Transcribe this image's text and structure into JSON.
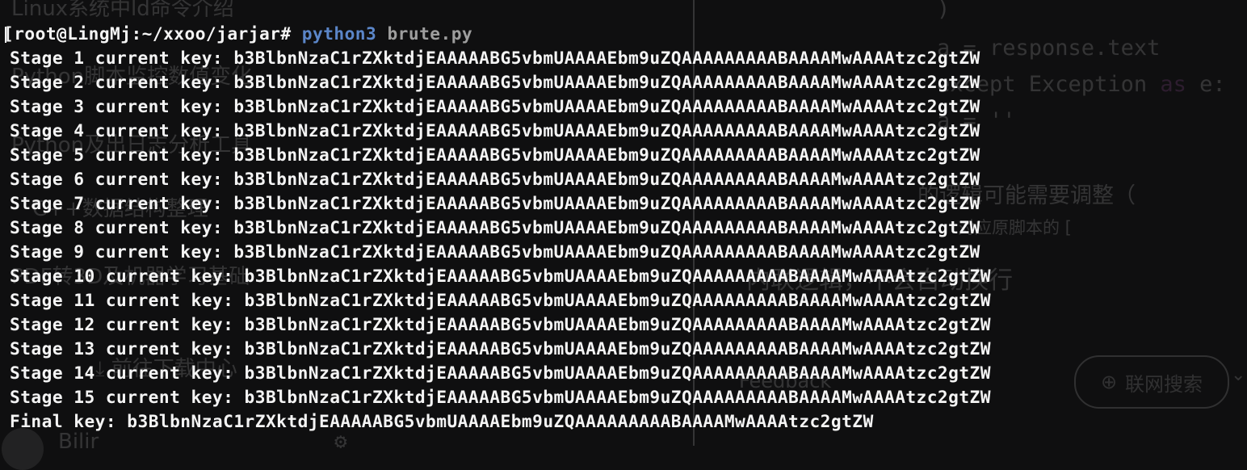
{
  "background": {
    "left_items": [
      "Linux系统中ld命令介绍",
      "Python脚本监控数值变化",
      "Python及出日志分析工具",
      "C++数据结构整理",
      "PDF转3D及机器学习基础",
      "前往下载中心",
      "Bilir"
    ],
    "code_lines": [
      {
        "text": ")"
      },
      {
        "text": "a = response.text"
      },
      {
        "pre": "except Exception ",
        "kw": "as",
        "post": " e:"
      },
      {
        "text": "a = ''"
      }
    ],
    "cjk_lines": [
      "的逻辑可能需要调整（",
      "对应原脚本的 [",
      "内联逻辑，不会自动换行",
      "Feedback"
    ],
    "search_button_label": "联网搜索",
    "search_button_icon": "globe-icon",
    "dropdown_icon": "chevron-down-icon"
  },
  "terminal": {
    "prompt": "[root@LingMj:~/xxoo/jarjar# ",
    "command": "python3",
    "argument": "brute.py",
    "stage_prefix": "Stage",
    "stage_suffix": "current key:",
    "stages": [
      {
        "label": "Stage 1 current key:",
        "key": "b3BlbnNzaC1rZXktdjEAAAAABG5vbmUAAAAEbm9uZQAAAAAAAAABAAAAMwAAAAtzc2gtZW"
      },
      {
        "label": "Stage 2 current key:",
        "key": "b3BlbnNzaC1rZXktdjEAAAAABG5vbmUAAAAEbm9uZQAAAAAAAAABAAAAMwAAAAtzc2gtZW"
      },
      {
        "label": "Stage 3 current key:",
        "key": "b3BlbnNzaC1rZXktdjEAAAAABG5vbmUAAAAEbm9uZQAAAAAAAAABAAAAMwAAAAtzc2gtZW"
      },
      {
        "label": "Stage 4 current key:",
        "key": "b3BlbnNzaC1rZXktdjEAAAAABG5vbmUAAAAEbm9uZQAAAAAAAAABAAAAMwAAAAtzc2gtZW"
      },
      {
        "label": "Stage 5 current key:",
        "key": "b3BlbnNzaC1rZXktdjEAAAAABG5vbmUAAAAEbm9uZQAAAAAAAAABAAAAMwAAAAtzc2gtZW"
      },
      {
        "label": "Stage 6 current key:",
        "key": "b3BlbnNzaC1rZXktdjEAAAAABG5vbmUAAAAEbm9uZQAAAAAAAAABAAAAMwAAAAtzc2gtZW"
      },
      {
        "label": "Stage 7 current key:",
        "key": "b3BlbnNzaC1rZXktdjEAAAAABG5vbmUAAAAEbm9uZQAAAAAAAAABAAAAMwAAAAtzc2gtZW"
      },
      {
        "label": "Stage 8 current key:",
        "key": "b3BlbnNzaC1rZXktdjEAAAAABG5vbmUAAAAEbm9uZQAAAAAAAAABAAAAMwAAAAtzc2gtZW"
      },
      {
        "label": "Stage 9 current key:",
        "key": "b3BlbnNzaC1rZXktdjEAAAAABG5vbmUAAAAEbm9uZQAAAAAAAAABAAAAMwAAAAtzc2gtZW"
      },
      {
        "label": "Stage 10 current key:",
        "key": "b3BlbnNzaC1rZXktdjEAAAAABG5vbmUAAAAEbm9uZQAAAAAAAAABAAAAMwAAAAtzc2gtZW"
      },
      {
        "label": "Stage 11 current key:",
        "key": "b3BlbnNzaC1rZXktdjEAAAAABG5vbmUAAAAEbm9uZQAAAAAAAAABAAAAMwAAAAtzc2gtZW"
      },
      {
        "label": "Stage 12 current key:",
        "key": "b3BlbnNzaC1rZXktdjEAAAAABG5vbmUAAAAEbm9uZQAAAAAAAAABAAAAMwAAAAtzc2gtZW"
      },
      {
        "label": "Stage 13 current key:",
        "key": "b3BlbnNzaC1rZXktdjEAAAAABG5vbmUAAAAEbm9uZQAAAAAAAAABAAAAMwAAAAtzc2gtZW"
      },
      {
        "label": "Stage 14 current key:",
        "key": "b3BlbnNzaC1rZXktdjEAAAAABG5vbmUAAAAEbm9uZQAAAAAAAAABAAAAMwAAAAtzc2gtZW"
      },
      {
        "label": "Stage 15 current key:",
        "key": "b3BlbnNzaC1rZXktdjEAAAAABG5vbmUAAAAEbm9uZQAAAAAAAAABAAAAMwAAAAtzc2gtZW"
      }
    ],
    "final_label": "Final key:",
    "final_key": "b3BlbnNzaC1rZXktdjEAAAAABG5vbmUAAAAEbm9uZQAAAAAAAAABAAAAMwAAAAtzc2gtZW"
  },
  "colors": {
    "terminal_bg": "#0f0f10",
    "text": "#f4f4f4",
    "command": "#5b86c9",
    "argument": "#9e9e9e"
  }
}
